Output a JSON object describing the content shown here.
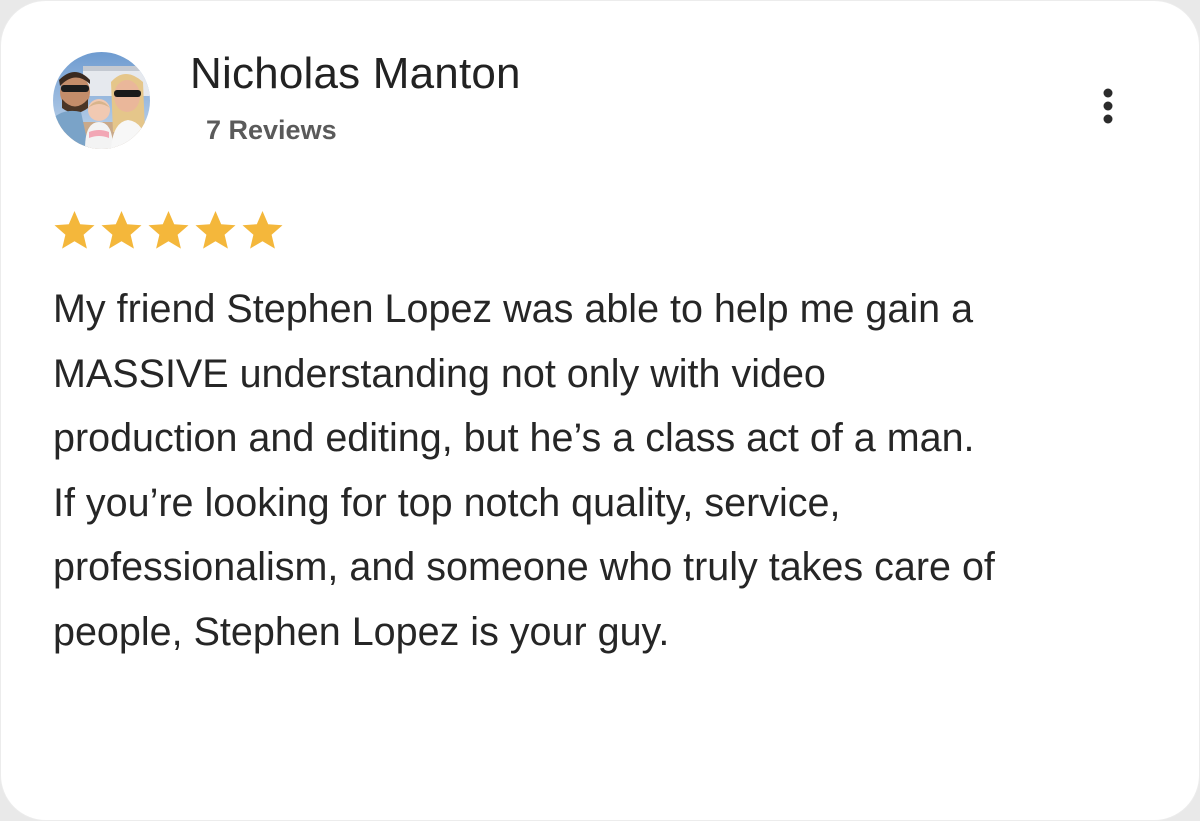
{
  "reviewer": {
    "name": "Nicholas Manton",
    "reviews_count": "7 Reviews",
    "avatar_icon": "profile-photo"
  },
  "menu_icon": "more-vert-icon",
  "rating": {
    "stars": 5,
    "max": 5,
    "star_color": "#f4b73b"
  },
  "review": {
    "lines": [
      "My friend Stephen Lopez was able to help me gain a",
      "MASSIVE understanding not only with video",
      "production and editing, but he’s a class act of a man.",
      "If you’re looking for top notch quality, service,",
      "professionalism, and someone who truly takes care of",
      "people, Stephen Lopez is your guy."
    ]
  },
  "colors": {
    "card_background": "#ffffff",
    "name_text": "#222222",
    "reviews_text": "#5a5a5a",
    "body_text": "#262626"
  }
}
